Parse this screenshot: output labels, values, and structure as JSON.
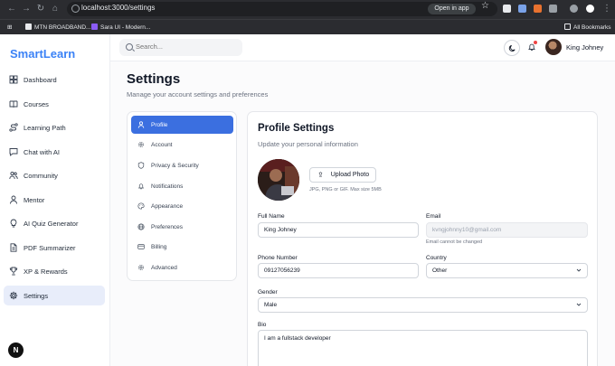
{
  "browser": {
    "url": "localhost:3000/settings",
    "open_in_app": "Open in app",
    "bookmarks": [
      "MTN BROADBAND...",
      "Sara UI - Modern..."
    ],
    "all_bookmarks": "All Bookmarks"
  },
  "app": {
    "logo": "SmartLearn",
    "search_placeholder": "Search...",
    "user_name": "King Johney",
    "corner_badge": "N"
  },
  "sidebar": {
    "items": [
      {
        "label": "Dashboard",
        "icon": "dashboard-icon"
      },
      {
        "label": "Courses",
        "icon": "book-icon"
      },
      {
        "label": "Learning Path",
        "icon": "route-icon"
      },
      {
        "label": "Chat with AI",
        "icon": "chat-icon"
      },
      {
        "label": "Community",
        "icon": "users-icon"
      },
      {
        "label": "Mentor",
        "icon": "user-icon"
      },
      {
        "label": "AI Quiz Generator",
        "icon": "lightbulb-icon"
      },
      {
        "label": "PDF Summarizer",
        "icon": "file-icon"
      },
      {
        "label": "XP & Rewards",
        "icon": "trophy-icon"
      },
      {
        "label": "Settings",
        "icon": "gear-icon",
        "active": true
      }
    ]
  },
  "page": {
    "title": "Settings",
    "subtitle": "Manage your account settings and preferences"
  },
  "settings_menu": [
    {
      "label": "Profile",
      "icon": "user-icon",
      "active": true
    },
    {
      "label": "Account",
      "icon": "gear-icon"
    },
    {
      "label": "Privacy & Security",
      "icon": "shield-icon"
    },
    {
      "label": "Notifications",
      "icon": "bell-icon"
    },
    {
      "label": "Appearance",
      "icon": "palette-icon"
    },
    {
      "label": "Preferences",
      "icon": "globe-icon"
    },
    {
      "label": "Billing",
      "icon": "card-icon"
    },
    {
      "label": "Advanced",
      "icon": "gear-icon"
    }
  ],
  "profile": {
    "title": "Profile Settings",
    "subtitle": "Update your personal information",
    "upload_label": "Upload Photo",
    "upload_hint": "JPG, PNG or GIF. Max size 5MB",
    "full_name_label": "Full Name",
    "full_name": "King Johney",
    "email_label": "Email",
    "email": "kvngjohnny10@gmail.com",
    "email_hint": "Email cannot be changed",
    "phone_label": "Phone Number",
    "phone": "09127056239",
    "country_label": "Country",
    "country": "Other",
    "gender_label": "Gender",
    "gender": "Male",
    "bio_label": "Bio",
    "bio": "I am a fullstack developer"
  },
  "colors": {
    "accent": "#3b6fe0",
    "logo": "#3b82f6",
    "active_nav_bg": "#e8edfa"
  }
}
